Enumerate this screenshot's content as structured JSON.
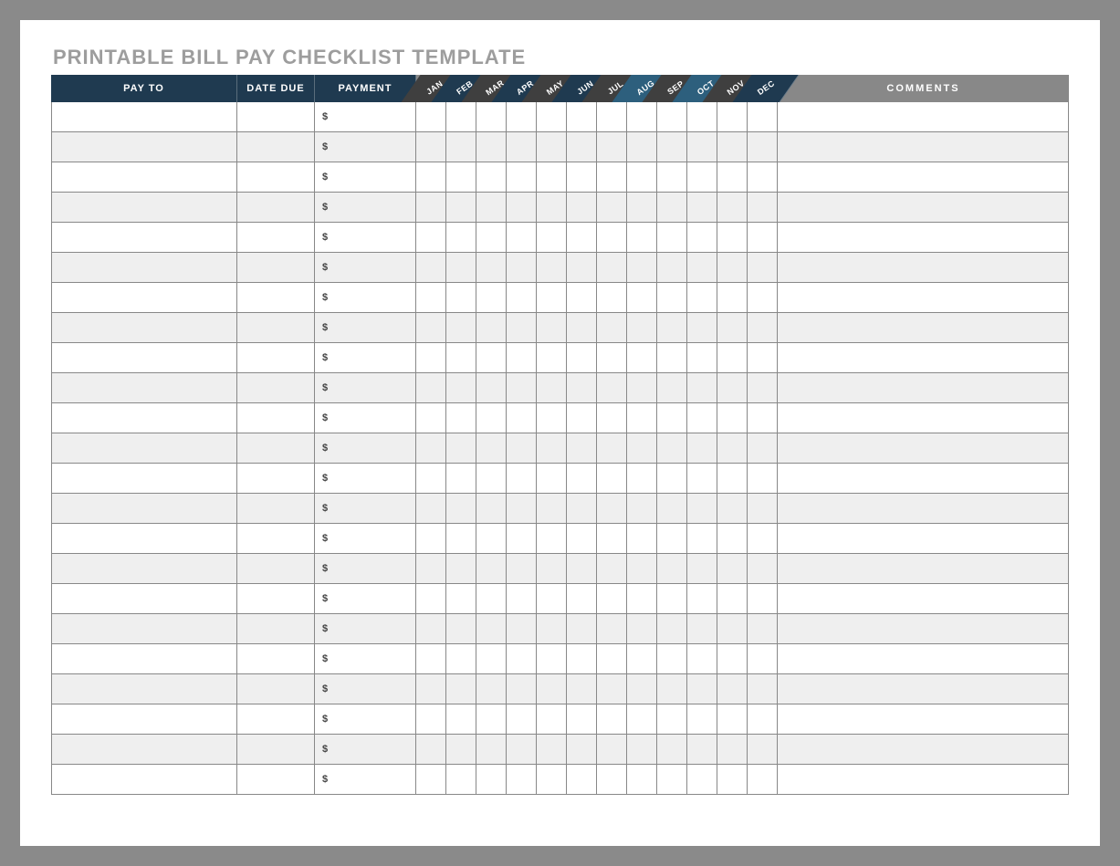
{
  "title": "PRINTABLE BILL PAY CHECKLIST TEMPLATE",
  "headers": {
    "pay_to": "PAY TO",
    "date_due": "DATE DUE",
    "payment": "PAYMENT",
    "comments": "COMMENTS"
  },
  "months": [
    "JAN",
    "FEB",
    "MAR",
    "APR",
    "MAY",
    "JUN",
    "JUL",
    "AUG",
    "SEP",
    "OCT",
    "NOV",
    "DEC"
  ],
  "month_colors": [
    "#3f3f3f",
    "#1f3a50",
    "#3f3f3f",
    "#1f3a50",
    "#3f3f3f",
    "#1f3a50",
    "#3f3f3f",
    "#2d5f7d",
    "#3f3f3f",
    "#2d5f7d",
    "#3f3f3f",
    "#1f3a50"
  ],
  "currency_symbol": "$",
  "rows": [
    {
      "pay_to": "",
      "date_due": "",
      "payment": "",
      "months": [
        "",
        "",
        "",
        "",
        "",
        "",
        "",
        "",
        "",
        "",
        "",
        ""
      ],
      "comments": ""
    },
    {
      "pay_to": "",
      "date_due": "",
      "payment": "",
      "months": [
        "",
        "",
        "",
        "",
        "",
        "",
        "",
        "",
        "",
        "",
        "",
        ""
      ],
      "comments": ""
    },
    {
      "pay_to": "",
      "date_due": "",
      "payment": "",
      "months": [
        "",
        "",
        "",
        "",
        "",
        "",
        "",
        "",
        "",
        "",
        "",
        ""
      ],
      "comments": ""
    },
    {
      "pay_to": "",
      "date_due": "",
      "payment": "",
      "months": [
        "",
        "",
        "",
        "",
        "",
        "",
        "",
        "",
        "",
        "",
        "",
        ""
      ],
      "comments": ""
    },
    {
      "pay_to": "",
      "date_due": "",
      "payment": "",
      "months": [
        "",
        "",
        "",
        "",
        "",
        "",
        "",
        "",
        "",
        "",
        "",
        ""
      ],
      "comments": ""
    },
    {
      "pay_to": "",
      "date_due": "",
      "payment": "",
      "months": [
        "",
        "",
        "",
        "",
        "",
        "",
        "",
        "",
        "",
        "",
        "",
        ""
      ],
      "comments": ""
    },
    {
      "pay_to": "",
      "date_due": "",
      "payment": "",
      "months": [
        "",
        "",
        "",
        "",
        "",
        "",
        "",
        "",
        "",
        "",
        "",
        ""
      ],
      "comments": ""
    },
    {
      "pay_to": "",
      "date_due": "",
      "payment": "",
      "months": [
        "",
        "",
        "",
        "",
        "",
        "",
        "",
        "",
        "",
        "",
        "",
        ""
      ],
      "comments": ""
    },
    {
      "pay_to": "",
      "date_due": "",
      "payment": "",
      "months": [
        "",
        "",
        "",
        "",
        "",
        "",
        "",
        "",
        "",
        "",
        "",
        ""
      ],
      "comments": ""
    },
    {
      "pay_to": "",
      "date_due": "",
      "payment": "",
      "months": [
        "",
        "",
        "",
        "",
        "",
        "",
        "",
        "",
        "",
        "",
        "",
        ""
      ],
      "comments": ""
    },
    {
      "pay_to": "",
      "date_due": "",
      "payment": "",
      "months": [
        "",
        "",
        "",
        "",
        "",
        "",
        "",
        "",
        "",
        "",
        "",
        ""
      ],
      "comments": ""
    },
    {
      "pay_to": "",
      "date_due": "",
      "payment": "",
      "months": [
        "",
        "",
        "",
        "",
        "",
        "",
        "",
        "",
        "",
        "",
        "",
        ""
      ],
      "comments": ""
    },
    {
      "pay_to": "",
      "date_due": "",
      "payment": "",
      "months": [
        "",
        "",
        "",
        "",
        "",
        "",
        "",
        "",
        "",
        "",
        "",
        ""
      ],
      "comments": ""
    },
    {
      "pay_to": "",
      "date_due": "",
      "payment": "",
      "months": [
        "",
        "",
        "",
        "",
        "",
        "",
        "",
        "",
        "",
        "",
        "",
        ""
      ],
      "comments": ""
    },
    {
      "pay_to": "",
      "date_due": "",
      "payment": "",
      "months": [
        "",
        "",
        "",
        "",
        "",
        "",
        "",
        "",
        "",
        "",
        "",
        ""
      ],
      "comments": ""
    },
    {
      "pay_to": "",
      "date_due": "",
      "payment": "",
      "months": [
        "",
        "",
        "",
        "",
        "",
        "",
        "",
        "",
        "",
        "",
        "",
        ""
      ],
      "comments": ""
    },
    {
      "pay_to": "",
      "date_due": "",
      "payment": "",
      "months": [
        "",
        "",
        "",
        "",
        "",
        "",
        "",
        "",
        "",
        "",
        "",
        ""
      ],
      "comments": ""
    },
    {
      "pay_to": "",
      "date_due": "",
      "payment": "",
      "months": [
        "",
        "",
        "",
        "",
        "",
        "",
        "",
        "",
        "",
        "",
        "",
        ""
      ],
      "comments": ""
    },
    {
      "pay_to": "",
      "date_due": "",
      "payment": "",
      "months": [
        "",
        "",
        "",
        "",
        "",
        "",
        "",
        "",
        "",
        "",
        "",
        ""
      ],
      "comments": ""
    },
    {
      "pay_to": "",
      "date_due": "",
      "payment": "",
      "months": [
        "",
        "",
        "",
        "",
        "",
        "",
        "",
        "",
        "",
        "",
        "",
        ""
      ],
      "comments": ""
    },
    {
      "pay_to": "",
      "date_due": "",
      "payment": "",
      "months": [
        "",
        "",
        "",
        "",
        "",
        "",
        "",
        "",
        "",
        "",
        "",
        ""
      ],
      "comments": ""
    },
    {
      "pay_to": "",
      "date_due": "",
      "payment": "",
      "months": [
        "",
        "",
        "",
        "",
        "",
        "",
        "",
        "",
        "",
        "",
        "",
        ""
      ],
      "comments": ""
    },
    {
      "pay_to": "",
      "date_due": "",
      "payment": "",
      "months": [
        "",
        "",
        "",
        "",
        "",
        "",
        "",
        "",
        "",
        "",
        "",
        ""
      ],
      "comments": ""
    }
  ]
}
